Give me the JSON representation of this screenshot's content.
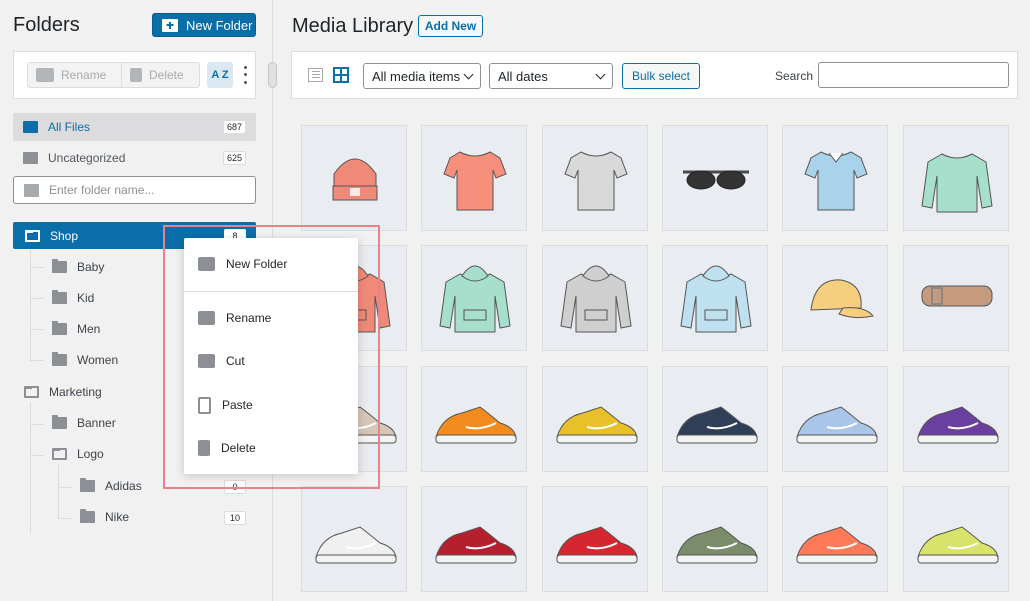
{
  "sidebar": {
    "title": "Folders",
    "new_folder_label": "New Folder",
    "toolbar": {
      "rename_label": "Rename",
      "delete_label": "Delete",
      "sort_label": "A Z"
    },
    "all_files": {
      "label": "All Files",
      "count": "687"
    },
    "uncategorized": {
      "label": "Uncategorized",
      "count": "625"
    },
    "search_placeholder": "Enter folder name...",
    "tree": [
      {
        "label": "Shop",
        "count": "8",
        "level": 0,
        "selected": true
      },
      {
        "label": "Baby",
        "level": 1
      },
      {
        "label": "Kid",
        "level": 1
      },
      {
        "label": "Men",
        "level": 1
      },
      {
        "label": "Women",
        "level": 1
      },
      {
        "label": "Marketing",
        "level": 0
      },
      {
        "label": "Banner",
        "level": 1
      },
      {
        "label": "Logo",
        "level": 1
      },
      {
        "label": "Adidas",
        "count": "0",
        "level": 2
      },
      {
        "label": "Nike",
        "count": "10",
        "level": 2
      }
    ]
  },
  "context_menu": {
    "items": [
      {
        "label": "New Folder",
        "icon": "folder-plus-icon"
      },
      {
        "label": "Rename",
        "icon": "folder-edit-icon"
      },
      {
        "label": "Cut",
        "icon": "folder-cut-icon"
      },
      {
        "label": "Paste",
        "icon": "clipboard-icon"
      },
      {
        "label": "Delete",
        "icon": "trash-icon"
      }
    ]
  },
  "main": {
    "title": "Media Library",
    "add_new_label": "Add New",
    "filters": {
      "media_type": "All media items",
      "dates": "All dates",
      "bulk_select_label": "Bulk select",
      "search_label": "Search",
      "search_value": ""
    },
    "grid": [
      {
        "item": "beanie",
        "color": "#f08a78"
      },
      {
        "item": "tshirt",
        "color": "#f6907c"
      },
      {
        "item": "tshirt",
        "color": "#d9d9d9"
      },
      {
        "item": "sunglasses",
        "color": "#4a4a4a"
      },
      {
        "item": "polo",
        "color": "#a9d3ea"
      },
      {
        "item": "sweatshirt",
        "color": "#a6e0cc"
      },
      {
        "item": "hoodie",
        "color": "#f08a78"
      },
      {
        "item": "hoodie",
        "color": "#a6e0cc"
      },
      {
        "item": "hoodie",
        "color": "#cfcfcf"
      },
      {
        "item": "hoodie",
        "color": "#bfe0ef"
      },
      {
        "item": "cap",
        "color": "#f6cf7e"
      },
      {
        "item": "belt",
        "color": "#c69a7c"
      },
      {
        "item": "sneaker",
        "color": "#d6c6b8"
      },
      {
        "item": "sneaker",
        "color": "#f28c1e"
      },
      {
        "item": "sneaker",
        "color": "#e8c12a"
      },
      {
        "item": "sneaker",
        "color": "#2e3f57"
      },
      {
        "item": "sneaker",
        "color": "#a9c6e8"
      },
      {
        "item": "sneaker",
        "color": "#6b3fa0"
      },
      {
        "item": "sneaker",
        "color": "#f0f0f0"
      },
      {
        "item": "sneaker",
        "color": "#b51f2e"
      },
      {
        "item": "sneaker",
        "color": "#d6262f"
      },
      {
        "item": "sneaker",
        "color": "#7a8c6a"
      },
      {
        "item": "sneaker",
        "color": "#ff7a59"
      },
      {
        "item": "sneaker",
        "color": "#d7e36a"
      }
    ]
  },
  "colors": {
    "accent": "#0a6fa8",
    "highlight": "#e9828b"
  }
}
